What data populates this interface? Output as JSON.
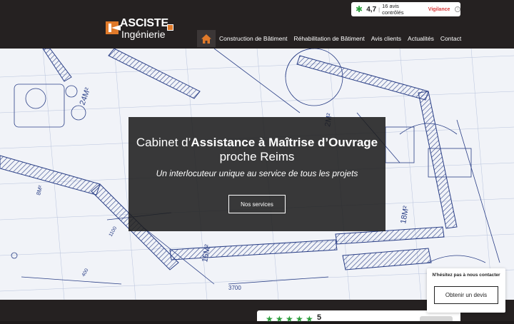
{
  "header": {
    "logo": {
      "top": "ASCISTE",
      "bottom": "Ingénierie"
    },
    "rating": {
      "score": "4,7",
      "separator": "|",
      "count": "16 avis contrôlés",
      "vigilance": "Vigilance",
      "info": "i"
    },
    "nav": [
      "Construction de Bâtiment",
      "Réhabilitation de Bâtiment",
      "Avis clients",
      "Actualités",
      "Contact"
    ]
  },
  "hero": {
    "title_plain_1": "Cabinet d’",
    "title_bold": "Assistance à Maîtrise d’Ouvrage",
    "title_plain_2": "proche Reims",
    "subtitle": "Un interlocuteur unique au service de tous les projets",
    "button": "Nos services",
    "blueprint_labels": [
      "24M²",
      "2M²",
      "18M²",
      "15M²",
      "24M²",
      "8M²",
      "3700",
      "1100",
      "400"
    ]
  },
  "contact_widget": {
    "title": "N'hésitez pas à nous contacter",
    "button": "Obtenir un devis"
  },
  "review_card": {
    "score": "5"
  },
  "colors": {
    "header_bg": "#252121",
    "accent": "#e07a2a",
    "green": "#2a9d3a",
    "blueprint": "#27408b"
  }
}
